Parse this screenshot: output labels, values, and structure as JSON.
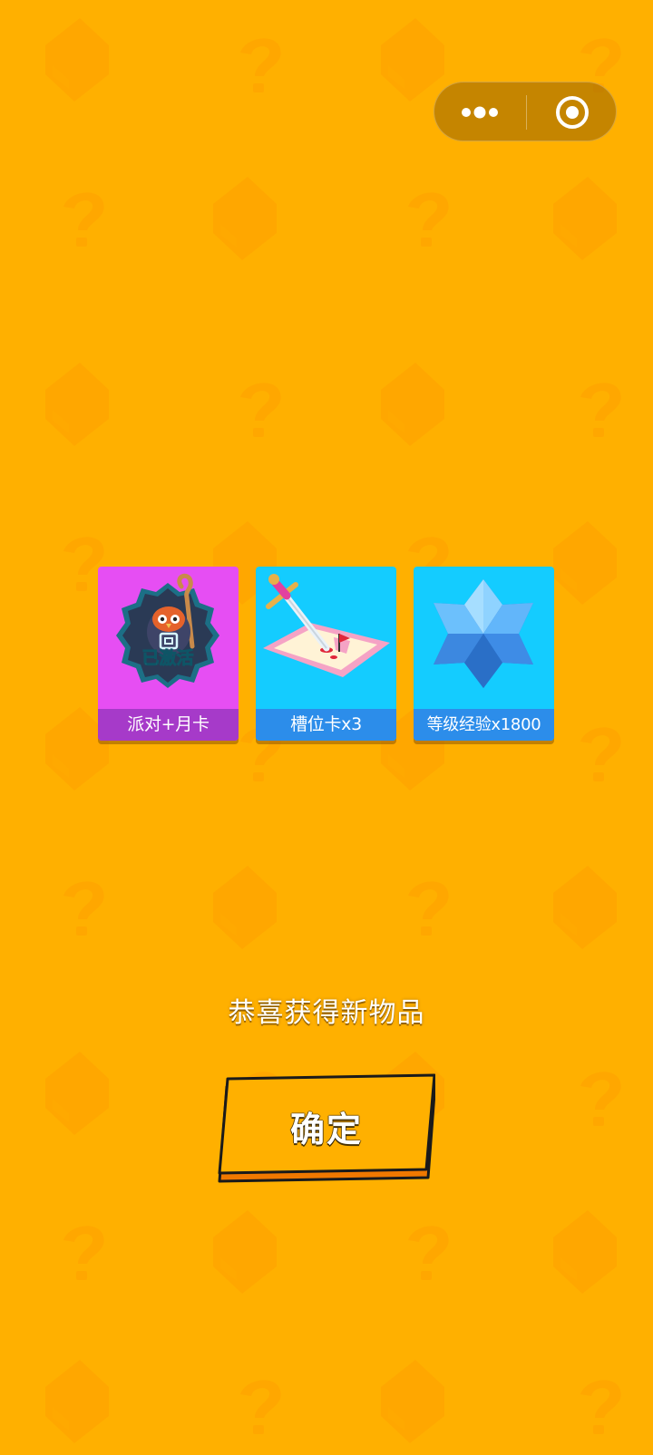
{
  "capsule": {
    "more_icon": "more-dots-icon",
    "close_icon": "target-circle-icon"
  },
  "items": [
    {
      "label": "派对+月卡",
      "badge_text": "已激活",
      "icon": "owl-avatar-badge-icon",
      "background": "#E64EF3",
      "label_background": "#A63AC9"
    },
    {
      "label": "槽位卡x3",
      "icon": "dagger-map-icon",
      "background": "#14CCFF",
      "label_background": "#2C8DEA"
    },
    {
      "label": "等级经验x1800",
      "icon": "blue-crystal-star-icon",
      "background": "#14CCFF",
      "label_background": "#2C8DEA"
    }
  ],
  "message": "恭喜获得新物品",
  "confirm_label": "确定",
  "colors": {
    "background": "#FFB000",
    "button": "#FFB000",
    "button_shadow": "#F07800"
  }
}
